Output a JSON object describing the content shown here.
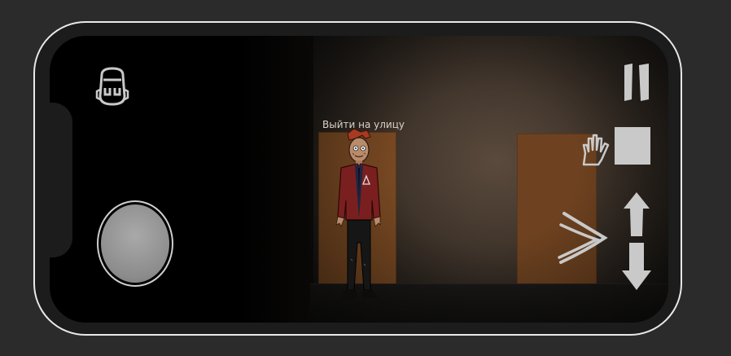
{
  "scene": {
    "interaction_hint": "Выйти на улицу",
    "location": "hallway"
  },
  "hud": {
    "left": {
      "inventory_icon": "backpack-icon",
      "joystick": "movement-joystick"
    },
    "right": {
      "pause_icon": "pause-icon",
      "interact_icon": "hand-icon",
      "action_icon": "square-icon",
      "run_icon": "double-chevron-right-icon",
      "up_icon": "arrow-up-icon",
      "down_icon": "arrow-down-icon"
    }
  },
  "colors": {
    "background": "#2b2b2b",
    "phone_outline": "#e8e8e8",
    "door": "#7a4a23",
    "hud_icons": "#c9c9c9",
    "character_jacket": "#7a1f1f",
    "character_hair": "#a83a22"
  }
}
